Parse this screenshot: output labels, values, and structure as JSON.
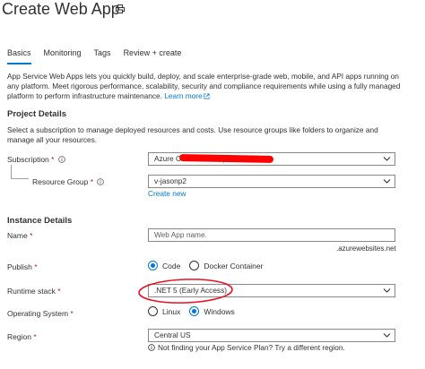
{
  "header": {
    "title": "Create Web App",
    "print_icon": "print-icon"
  },
  "tabs": [
    {
      "label": "Basics",
      "active": true
    },
    {
      "label": "Monitoring",
      "active": false
    },
    {
      "label": "Tags",
      "active": false
    },
    {
      "label": "Review + create",
      "active": false
    }
  ],
  "intro": {
    "text": "App Service Web Apps lets you quickly build, deploy, and scale enterprise-grade web, mobile, and API apps running on any platform. Meet rigorous performance, scalability, security and compliance requirements while using a fully managed platform to perform infrastructure maintenance.",
    "learn_more": "Learn more"
  },
  "project_details": {
    "title": "Project Details",
    "description": "Select a subscription to manage deployed resources and costs. Use resource groups like folders to organize and manage all your resources.",
    "subscription_label": "Subscription",
    "subscription_value": "Azure C                              nal Consumption",
    "resource_group_label": "Resource Group",
    "resource_group_value": "v-jasonp2",
    "create_new": "Create new"
  },
  "instance_details": {
    "title": "Instance Details",
    "name_label": "Name",
    "name_placeholder": "Web App name.",
    "name_suffix": ".azurewebsites.net",
    "publish_label": "Publish",
    "publish_options": [
      "Code",
      "Docker Container"
    ],
    "publish_selected": "Code",
    "runtime_label": "Runtime stack",
    "runtime_value": ".NET 5 (Early Access)",
    "os_label": "Operating System",
    "os_options": [
      "Linux",
      "Windows"
    ],
    "os_selected": "Windows",
    "region_label": "Region",
    "region_value": "Central US",
    "region_hint": "Not finding your App Service Plan? Try a different region."
  },
  "required_marker": "*",
  "colors": {
    "accent": "#0078d4",
    "required": "#a4262c",
    "annotation": "#e81123"
  }
}
